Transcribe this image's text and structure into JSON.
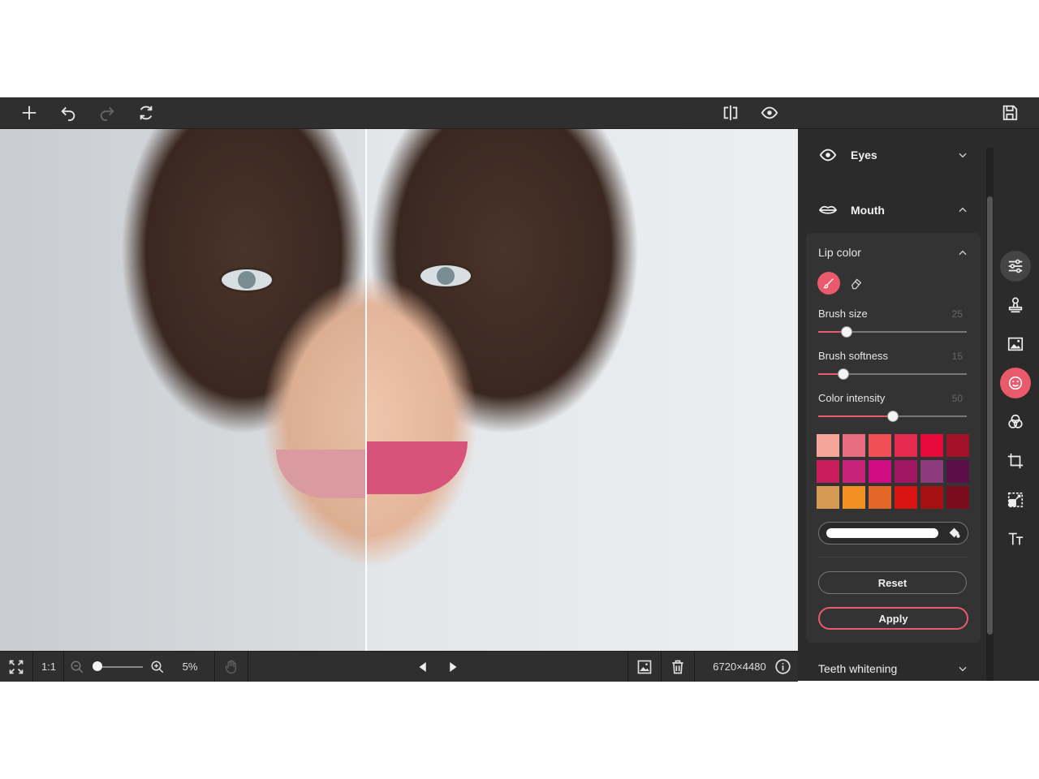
{
  "toolbar": {
    "icons": [
      "plus-icon",
      "undo-icon",
      "redo-icon",
      "refresh-icon",
      "compare-split-icon",
      "eye-preview-icon",
      "save-icon"
    ]
  },
  "canvas": {
    "description_alt": "Before/after portrait comparison",
    "split_position_pct": 46
  },
  "statusbar": {
    "one_to_one": "1:1",
    "zoom": "5%",
    "zoom_slider_value_pct": 0,
    "dimensions": "6720×4480"
  },
  "panel": {
    "eyes_label": "Eyes",
    "mouth_label": "Mouth",
    "lip_color_label": "Lip color",
    "brush_size_label": "Brush size",
    "brush_size_value": "25",
    "brush_size_pct": 19,
    "brush_softness_label": "Brush softness",
    "brush_softness_value": "15",
    "brush_softness_pct": 17,
    "color_intensity_label": "Color intensity",
    "color_intensity_value": "50",
    "color_intensity_pct": 50,
    "swatches": [
      "#f5a59a",
      "#e86c80",
      "#f04f55",
      "#e6294f",
      "#e8083a",
      "#a4122a",
      "#c91d5e",
      "#c8237a",
      "#d30b83",
      "#a01660",
      "#8c3b7c",
      "#5a0f49",
      "#d69a55",
      "#f39023",
      "#e36629",
      "#d91212",
      "#a61212",
      "#7a0d1d"
    ],
    "custom_color": "#ffffff",
    "reset_label": "Reset",
    "apply_label": "Apply",
    "teeth_label": "Teeth whitening",
    "accent": "#e85a6c"
  },
  "rail": {
    "icons": [
      "adjustments-icon",
      "stamp-icon",
      "image-icon",
      "face-retouch-icon",
      "color-circles-icon",
      "crop-icon",
      "resize-icon",
      "text-icon"
    ],
    "active": "face-retouch-icon"
  }
}
